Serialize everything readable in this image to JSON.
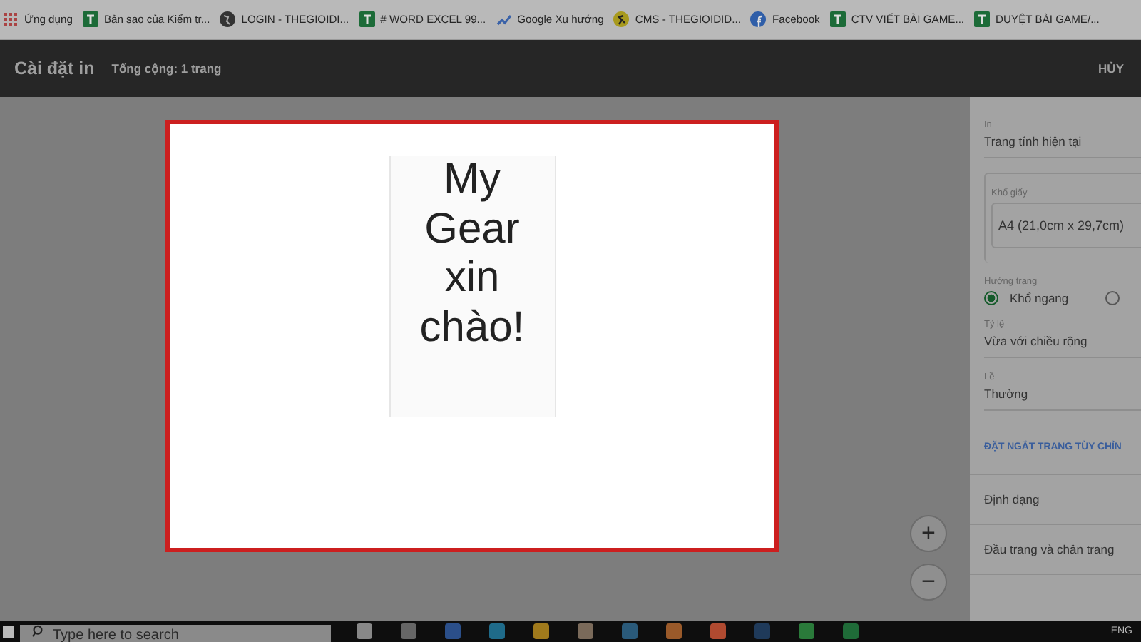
{
  "bookmarks": [
    {
      "kind": "apps",
      "label": "Ứng dụng"
    },
    {
      "kind": "sheet",
      "label": "Bản sao của Kiểm tr..."
    },
    {
      "kind": "globe",
      "label": "LOGIN - THEGIOIDI..."
    },
    {
      "kind": "sheet",
      "label": "# WORD EXCEL 99..."
    },
    {
      "kind": "trend",
      "label": "Google Xu hướng"
    },
    {
      "kind": "runner",
      "label": "CMS - THEGIOIDID..."
    },
    {
      "kind": "facebook",
      "label": "Facebook"
    },
    {
      "kind": "sheet",
      "label": "CTV VIẾT BÀI GAME..."
    },
    {
      "kind": "sheet",
      "label": "DUYỆT BÀI GAME/..."
    }
  ],
  "header": {
    "title": "Cài đặt in",
    "subtitle": "Tổng cộng: 1 trang",
    "cancel": "HỦY"
  },
  "preview": {
    "lines": [
      "My",
      "Gear",
      "xin",
      "chào!"
    ],
    "zoom_in": "+",
    "zoom_out": "−"
  },
  "settings": [
    {
      "kind": "select",
      "label": "In",
      "value": "Trang tính hiện tại"
    },
    {
      "kind": "box",
      "label": "Khổ giấy",
      "value": "A4 (21,0cm x 29,7cm)"
    },
    {
      "kind": "radio",
      "label": "Hướng trang",
      "options": [
        {
          "label": "Khổ ngang",
          "selected": true
        },
        {
          "selected": false
        }
      ]
    },
    {
      "kind": "select",
      "label": "Tỷ lệ",
      "value": "Vừa với chiều rộng"
    },
    {
      "kind": "select",
      "label": "Lề",
      "value": "Thường"
    },
    {
      "kind": "link",
      "value": "ĐẶT NGẮT TRANG TÙY CHỈN"
    },
    {
      "kind": "section",
      "value": "Định dạng"
    },
    {
      "kind": "section",
      "value": "Đầu trang và chân trang"
    }
  ],
  "taskbar": {
    "search_placeholder": "Type here to search",
    "language": "ENG"
  }
}
